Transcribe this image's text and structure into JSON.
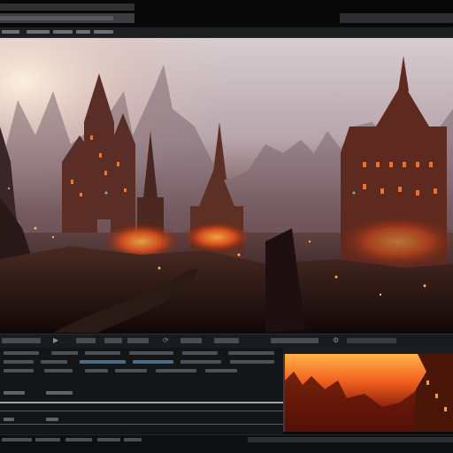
{
  "app": {
    "window_title": "",
    "accent_color": "#4a6c8a"
  },
  "viewer": {
    "image_subject_icon": "fantasy-city-render"
  },
  "preview": {
    "image_subject_icon": "preview-thumbnail-render"
  },
  "icons": {
    "play": "play-icon",
    "loop": "loop-icon",
    "settings": "gear-icon"
  }
}
